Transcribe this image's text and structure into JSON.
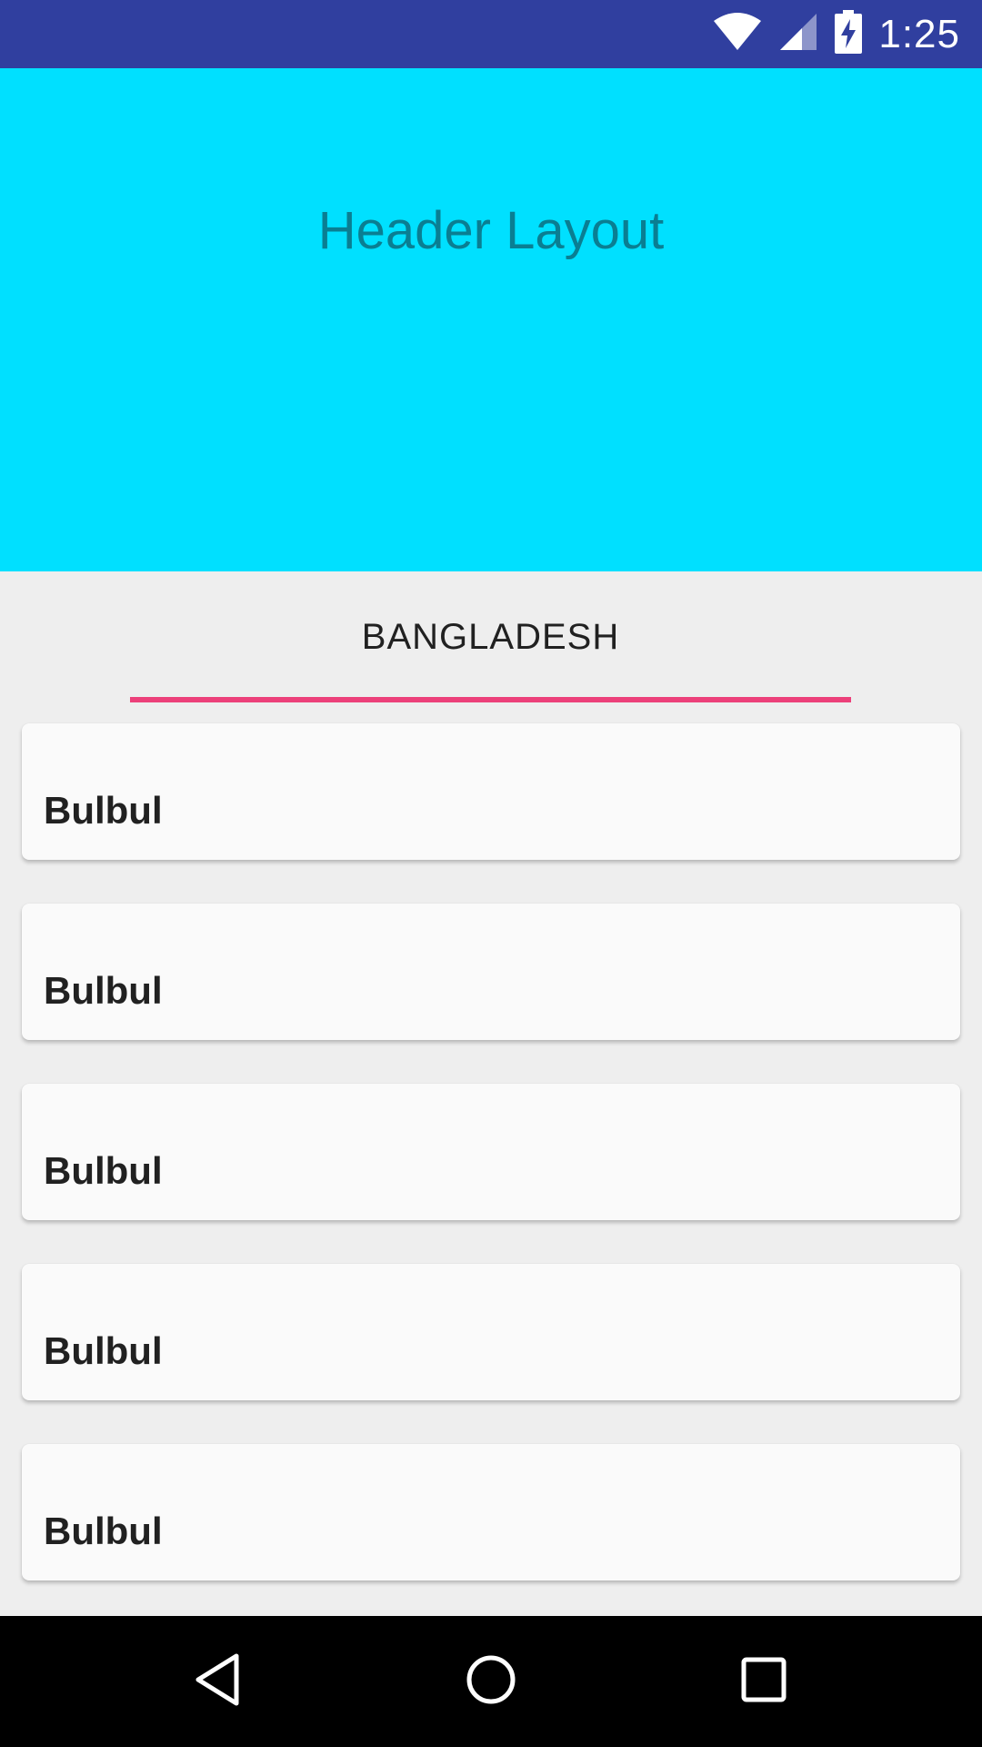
{
  "status_bar": {
    "time": "1:25",
    "icons": [
      "wifi-icon",
      "cell-signal-icon",
      "battery-charging-icon"
    ],
    "background": "#303f9f"
  },
  "header": {
    "title": "Header Layout",
    "background": "#00e0ff",
    "title_color": "#0a7e92"
  },
  "tabs": {
    "items": [
      {
        "label": "BANGLADESH",
        "selected": true
      }
    ],
    "indicator_color": "#ec407a"
  },
  "list": {
    "items": [
      {
        "label": "Bulbul"
      },
      {
        "label": "Bulbul"
      },
      {
        "label": "Bulbul"
      },
      {
        "label": "Bulbul"
      },
      {
        "label": "Bulbul"
      }
    ]
  },
  "nav_bar": {
    "buttons": [
      "back-icon",
      "home-icon",
      "recents-icon"
    ]
  }
}
